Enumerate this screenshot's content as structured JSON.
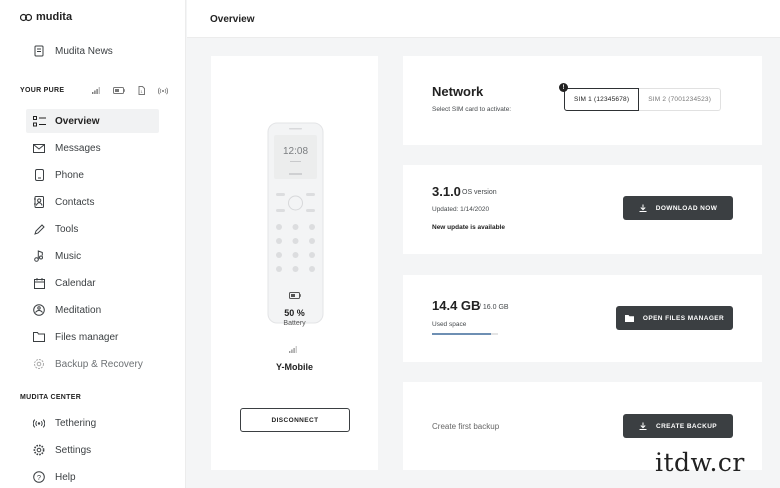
{
  "sidebar": {
    "logo": "mudita",
    "news_label": "Mudita News",
    "your_pure_title": "YOUR PURE",
    "items": [
      {
        "label": "Overview"
      },
      {
        "label": "Messages"
      },
      {
        "label": "Phone"
      },
      {
        "label": "Contacts"
      },
      {
        "label": "Tools"
      },
      {
        "label": "Music"
      },
      {
        "label": "Calendar"
      },
      {
        "label": "Meditation"
      },
      {
        "label": "Files manager"
      },
      {
        "label": "Backup & Recovery"
      }
    ],
    "mudita_center_title": "MUDITA CENTER",
    "center_items": [
      {
        "label": "Tethering"
      },
      {
        "label": "Settings"
      },
      {
        "label": "Help"
      }
    ]
  },
  "header": {
    "title": "Overview"
  },
  "phone": {
    "clock": "12:08",
    "battery_value": "50 %",
    "battery_label": "Battery",
    "operator": "Y-Mobile",
    "disconnect_label": "DISCONNECT"
  },
  "network": {
    "title": "Network",
    "subtitle": "Select SIM card to activate:",
    "badge": "!",
    "sim1": "SIM 1 (12345678)",
    "sim2": "SIM 2 (7001234523)"
  },
  "os": {
    "version": "3.1.0",
    "version_label": "OS version",
    "updated": "Updated: 1/14/2020",
    "update_note": "New update is available",
    "download_label": "DOWNLOAD NOW"
  },
  "files": {
    "used": "14.4 GB",
    "total": "/ 16.0 GB",
    "used_label": "Used space",
    "used_fraction": 0.9,
    "open_label": "OPEN FILES MANAGER"
  },
  "backup": {
    "text": "Create first backup",
    "button_label": "CREATE BACKUP"
  },
  "watermark": "itdw.cr",
  "colors": {
    "dark_button": "#3b3f42",
    "accent_progress": "#6e8fb3"
  }
}
